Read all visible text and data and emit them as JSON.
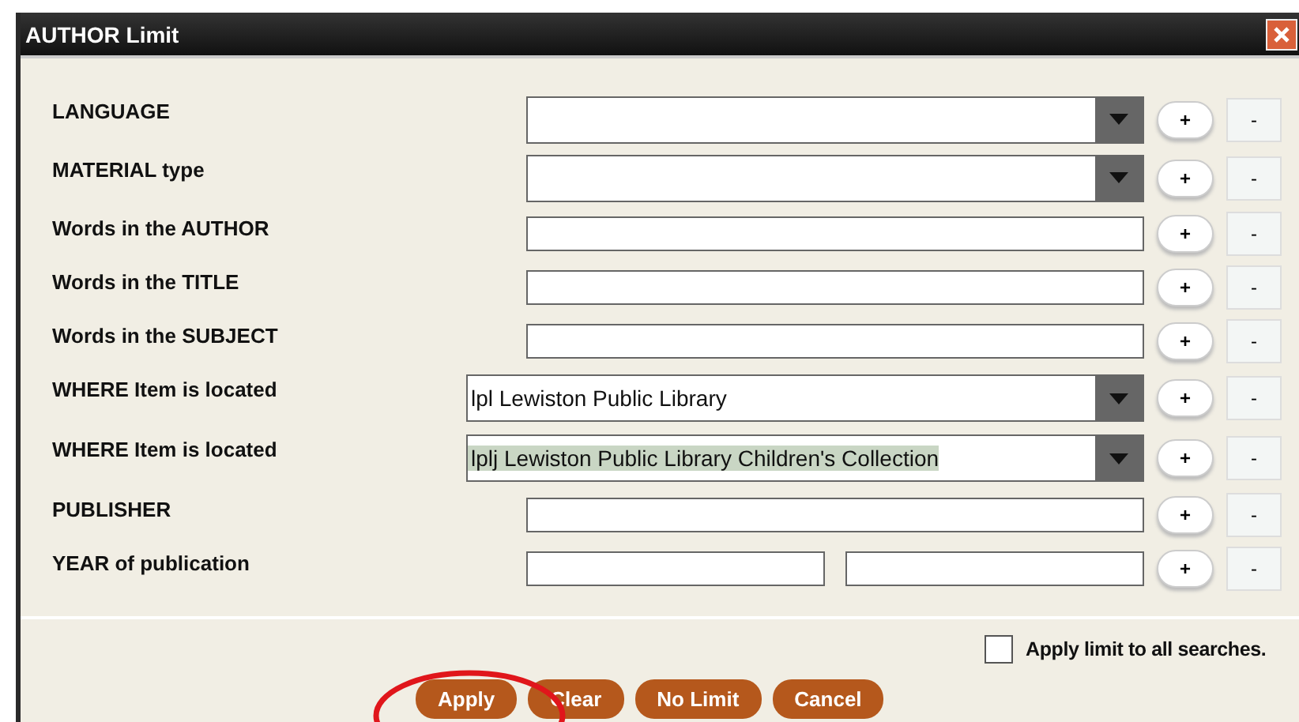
{
  "window": {
    "title": "AUTHOR Limit"
  },
  "rows": [
    {
      "label": "LANGUAGE",
      "kind": "select",
      "value": ""
    },
    {
      "label": "MATERIAL type",
      "kind": "select",
      "value": ""
    },
    {
      "label": "Words in the AUTHOR",
      "kind": "text",
      "value": ""
    },
    {
      "label": "Words in the TITLE",
      "kind": "text",
      "value": ""
    },
    {
      "label": "Words in the SUBJECT",
      "kind": "text",
      "value": ""
    },
    {
      "label": "WHERE Item is located",
      "kind": "select",
      "wide": true,
      "value": "lpl Lewiston Public Library",
      "text_selected": false
    },
    {
      "label": "WHERE Item is located",
      "kind": "select",
      "wide": true,
      "value": "lplj Lewiston Public Library Children's Collection",
      "text_selected": true
    },
    {
      "label": "PUBLISHER",
      "kind": "text",
      "value": ""
    },
    {
      "label": "YEAR of publication",
      "kind": "range",
      "value": ""
    }
  ],
  "add_label": "+",
  "remove_label": "-",
  "apply_all": {
    "label": "Apply limit to all searches.",
    "checked": false
  },
  "buttons": [
    "Apply",
    "Clear",
    "No Limit",
    "Cancel"
  ]
}
